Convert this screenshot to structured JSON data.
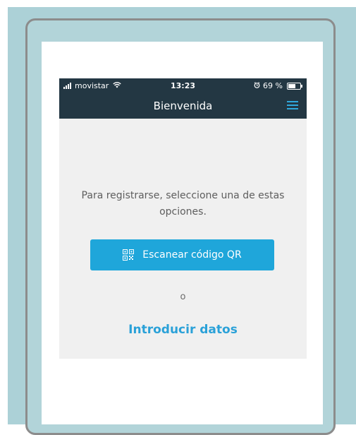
{
  "status_bar": {
    "carrier": "movistar",
    "time": "13:23",
    "battery_percent": "69 %",
    "battery_level": 0.69,
    "alarm_icon": "alarm-icon",
    "wifi_icon": "wifi-icon"
  },
  "nav": {
    "title": "Bienvenida",
    "menu_icon": "hamburger-menu-icon"
  },
  "main": {
    "prompt": "Para registrarse, seleccione una de estas opciones.",
    "scan_button_label": "Escanear código QR",
    "scan_button_icon": "qr-code-icon",
    "or_text": "o",
    "enter_data_link": "Introducir datos"
  },
  "colors": {
    "header_background": "#233743",
    "accent": "#1fa6da",
    "panel_background": "#f0f0f0",
    "backdrop": "#acd1d7"
  }
}
